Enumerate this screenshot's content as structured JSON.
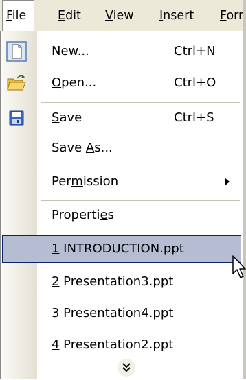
{
  "menubar": {
    "items": [
      {
        "label": "File",
        "mnemonic_index": 0
      },
      {
        "label": "Edit",
        "mnemonic_index": 0
      },
      {
        "label": "View",
        "mnemonic_index": 0
      },
      {
        "label": "Insert",
        "mnemonic_index": 0
      },
      {
        "label": "Form",
        "mnemonic_index": 0
      }
    ],
    "open_menu": "File"
  },
  "file_menu": {
    "items": [
      {
        "id": "new",
        "label": "New...",
        "mnemonic_index": 0,
        "shortcut": "Ctrl+N",
        "icon": "new-document-icon"
      },
      {
        "id": "open",
        "label": "Open...",
        "mnemonic_index": 0,
        "shortcut": "Ctrl+O",
        "icon": "open-folder-icon"
      },
      {
        "id": "save",
        "label": "Save",
        "mnemonic_index": 0,
        "shortcut": "Ctrl+S",
        "icon": "save-disk-icon"
      },
      {
        "id": "save_as",
        "label": "Save As...",
        "mnemonic_index": 5
      },
      {
        "id": "permission",
        "label": "Permission",
        "mnemonic_index": 3,
        "submenu": true
      },
      {
        "id": "properties",
        "label": "Properties",
        "mnemonic_index": 8
      },
      {
        "id": "recent1",
        "label": "1 INTRODUCTION.ppt",
        "mnemonic_index": 0,
        "highlighted": true
      },
      {
        "id": "recent2",
        "label": "2 Presentation3.ppt",
        "mnemonic_index": 0
      },
      {
        "id": "recent3",
        "label": "3 Presentation4.ppt",
        "mnemonic_index": 0
      },
      {
        "id": "recent4",
        "label": "4 Presentation2.ppt",
        "mnemonic_index": 0
      }
    ],
    "expand_icon": "double-chevron-down-icon"
  },
  "colors": {
    "menubar_bg": "#ece9d8",
    "highlight_bg": "#b6bdd2",
    "highlight_border": "#0a246a"
  }
}
